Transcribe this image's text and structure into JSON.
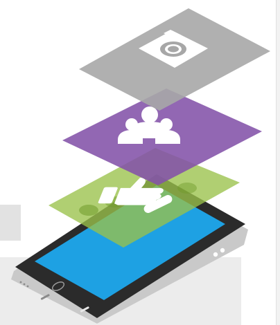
{
  "illustration": {
    "layers": [
      {
        "id": "camera-layer",
        "icon": "camera-icon",
        "color": "#a7a7a7",
        "opacity": 0.9
      },
      {
        "id": "people-layer",
        "icon": "people-icon",
        "color": "#8352a8",
        "opacity": 0.88
      },
      {
        "id": "like-layer",
        "icon": "thumbs-up-icon",
        "color": "#9ac24a",
        "opacity": 0.78
      }
    ],
    "phone": {
      "body_color": "#2b2b2b",
      "frame_color": "#c9c9c9",
      "screen_color": "#1ea1e3"
    }
  }
}
